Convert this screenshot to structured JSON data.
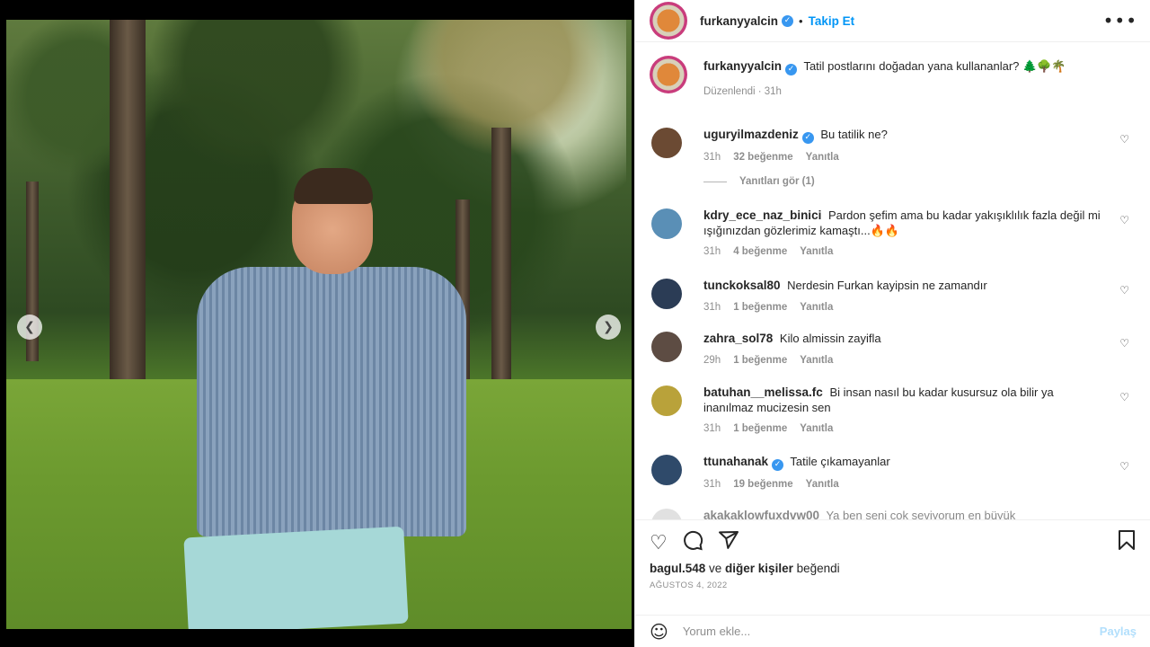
{
  "post": {
    "author": "furkanyyalcin",
    "verified_icon": "verified-badge-icon",
    "dot": "•",
    "follow_label": "Takip Et",
    "more_icon": "more-options-icon"
  },
  "caption": {
    "username": "furkanyyalcin",
    "text": "Tatil postlarını doğadan yana kullananlar? 🌲🌳🌴",
    "edited_label": "Düzenlendi · 31h"
  },
  "comments": [
    {
      "username": "uguryilmazdeniz",
      "verified": true,
      "text": "Bu tatilik ne?",
      "time": "31h",
      "likes": "32 beğenme",
      "reply": "Yanıtla",
      "avatar_color": "#6b4a33"
    },
    {
      "username": "kdry_ece_naz_binici",
      "verified": false,
      "text": "Pardon şefim ama bu kadar yakışıklılık fazla değil mi ışığınızdan gözlerimiz kamaştı...🔥🔥",
      "time": "31h",
      "likes": "4 beğenme",
      "reply": "Yanıtla",
      "avatar_color": "#5a8fb6"
    },
    {
      "username": "tunckoksal80",
      "verified": false,
      "text": "Nerdesin Furkan kayipsin ne zamandır",
      "time": "31h",
      "likes": "1 beğenme",
      "reply": "Yanıtla",
      "avatar_color": "#2b3c55"
    },
    {
      "username": "zahra_sol78",
      "verified": false,
      "text": "Kilo almissin zayifla",
      "time": "29h",
      "likes": "1 beğenme",
      "reply": "Yanıtla",
      "avatar_color": "#5d4c43"
    },
    {
      "username": "batuhan__melissa.fc",
      "verified": false,
      "text": "Bi insan nasıl bu kadar kusursuz ola bilir ya inanılmaz mucizesin sen",
      "time": "31h",
      "likes": "1 beğenme",
      "reply": "Yanıtla",
      "avatar_color": "#b9a23a"
    },
    {
      "username": "ttunahanak",
      "verified": true,
      "text": "Tatile çıkamayanlar",
      "time": "31h",
      "likes": "19 beğenme",
      "reply": "Yanıtla",
      "avatar_color": "#2f4a6a"
    }
  ],
  "view_replies": "Yanıtları gör (1)",
  "partial_comment": {
    "username": "akakaklowfuxdvw00",
    "text": "Ya ben seni çok seviyorum en büyük"
  },
  "actions": {
    "like_icon": "heart-icon",
    "comment_icon": "comment-icon",
    "share_icon": "send-icon",
    "save_icon": "bookmark-icon"
  },
  "likes": {
    "first_user": "bagul.548",
    "connector": " ve ",
    "others": "diğer kişiler",
    "suffix": " beğendi"
  },
  "date": "AĞUSTOS 4, 2022",
  "add_comment": {
    "placeholder": "Yorum ekle...",
    "post_label": "Paylaş"
  },
  "colors": {
    "accent_blue": "#0095f6",
    "verified_blue": "#3897f0",
    "muted": "#8e8e8e"
  }
}
